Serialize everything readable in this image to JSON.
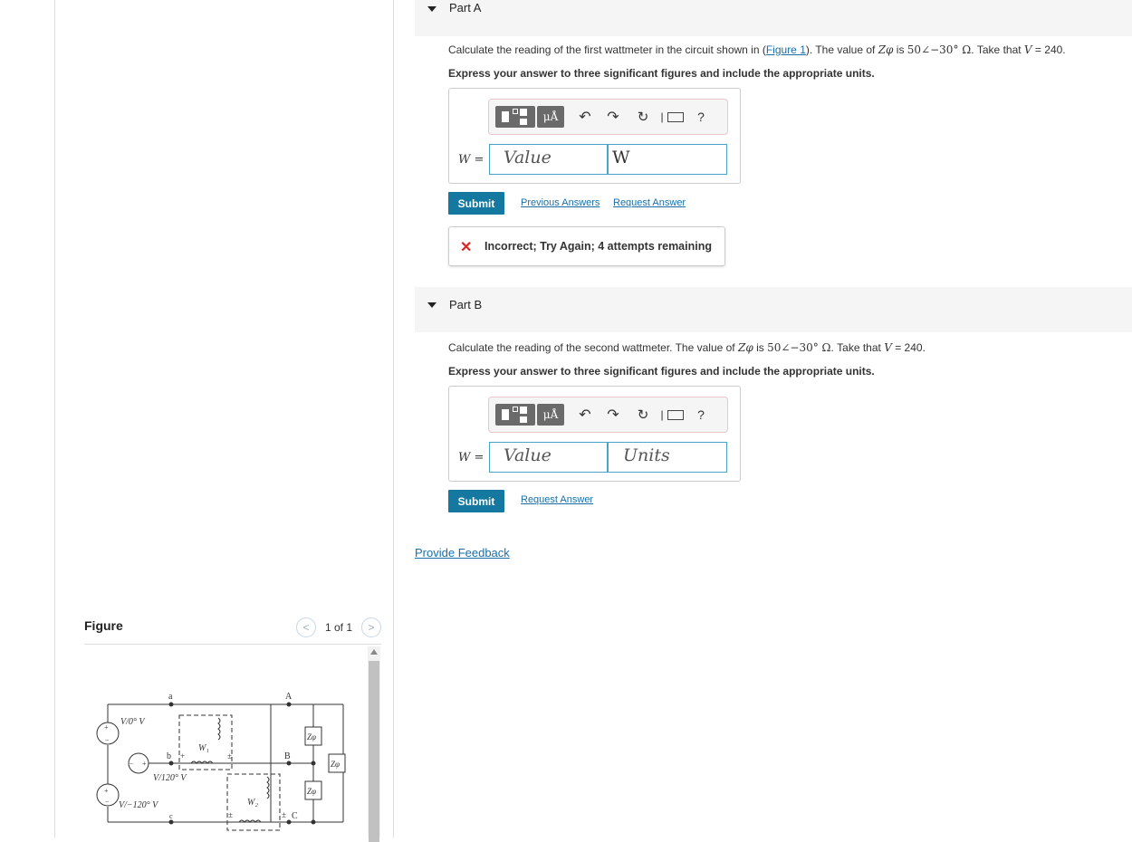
{
  "figure": {
    "title": "Figure",
    "pager_text": "1 of 1",
    "prev_icon": "chevron-left-icon",
    "next_icon": "chevron-right-icon"
  },
  "circuit": {
    "node_a": "a",
    "node_b": "b",
    "node_c": "c",
    "node_A": "A",
    "node_B": "B",
    "node_C": "C",
    "src1": "V/0° V",
    "src2": "V/120° V",
    "src3": "V/−120° V",
    "w1": "W₁",
    "w2": "W₂",
    "z": "Zφ"
  },
  "partA": {
    "label": "Part A",
    "q_prefix": "Calculate the reading of the first wattmeter in the circuit shown in (",
    "q_link": "Figure 1",
    "q_mid": "). The value of ",
    "q_z": "Zφ",
    "q_is": " is ",
    "q_val": "50∠−30° Ω",
    "q_take": ". Take that ",
    "q_v": "V",
    "q_end": " = 240.",
    "instruction": "Express your answer to three significant figures and include the appropriate units.",
    "w_label": "W =",
    "value_placeholder": "Value",
    "units_value": "W",
    "submit": "Submit",
    "previous_answers": "Previous Answers",
    "request_answer": "Request Answer",
    "feedback": "Incorrect; Try Again; 4 attempts remaining"
  },
  "partB": {
    "label": "Part B",
    "q_prefix": "Calculate the reading of the second wattmeter. The value of ",
    "q_z": "Zφ",
    "q_is": " is ",
    "q_val": "50∠−30° Ω",
    "q_take": ". Take that ",
    "q_v": "V",
    "q_end": " = 240.",
    "instruction": "Express your answer to three significant figures and include the appropriate units.",
    "w_label": "W =",
    "value_placeholder": "Value",
    "units_placeholder": "Units",
    "submit": "Submit",
    "request_answer": "Request Answer"
  },
  "toolbar": {
    "unit_label": "μÅ",
    "undo_icon": "undo-icon",
    "redo_icon": "redo-icon",
    "reset_icon": "reset-icon",
    "keyboard_icon": "keyboard-icon",
    "help": "?"
  },
  "provide_feedback": "Provide Feedback"
}
